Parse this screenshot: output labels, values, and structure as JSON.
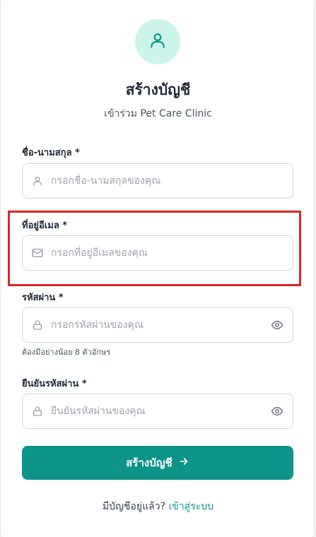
{
  "header": {
    "icon": "user-icon",
    "title": "สร้างบัญชี",
    "subtitle": "เข้าร่วม Pet Care Clinic"
  },
  "form": {
    "name": {
      "label": "ชื่อ-นามสกุล *",
      "placeholder": "กรอกชื่อ-นามสกุลของคุณ",
      "icon": "user-icon"
    },
    "email": {
      "label": "ที่อยู่อีเมล *",
      "placeholder": "กรอกที่อยู่อีเมลของคุณ",
      "icon": "mail-icon"
    },
    "password": {
      "label": "รหัสผ่าน *",
      "placeholder": "กรอกรหัสผ่านของคุณ",
      "icon": "lock-icon",
      "hint": "ต้องมีอย่างน้อย 8 ตัวอักษร"
    },
    "confirm_password": {
      "label": "ยืนยันรหัสผ่าน *",
      "placeholder": "ยืนยันรหัสผ่านของคุณ",
      "icon": "lock-icon"
    },
    "submit_label": "สร้างบัญชี"
  },
  "footer": {
    "prompt": "มีบัญชีอยู่แล้ว?",
    "login_link": "เข้าสู่ระบบ"
  },
  "colors": {
    "accent": "#0d9488",
    "accent_light": "#ccf4ea",
    "highlight": "#dc2626"
  }
}
